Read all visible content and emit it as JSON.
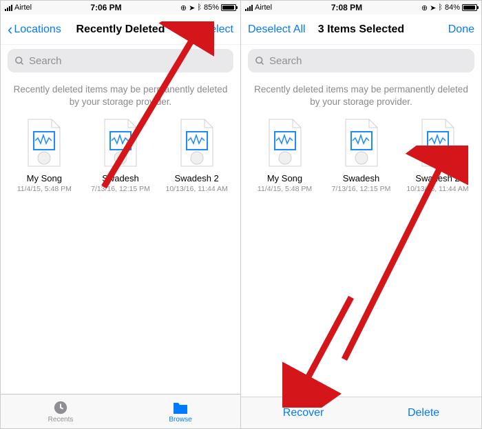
{
  "left": {
    "status": {
      "carrier": "Airtel",
      "time": "7:06 PM",
      "battery_pct": "85%",
      "battery_fill_pct": 85
    },
    "nav": {
      "back_label": "Locations",
      "title": "Recently Deleted",
      "action_label": "Select"
    },
    "search": {
      "placeholder": "Search"
    },
    "info_text": "Recently deleted items may be permanently deleted by your storage provider.",
    "files": [
      {
        "name": "My Song",
        "date": "11/4/15, 5:48 PM"
      },
      {
        "name": "Swadesh",
        "date": "7/13/16, 12:15 PM"
      },
      {
        "name": "Swadesh 2",
        "date": "10/13/16, 11:44 AM"
      }
    ],
    "tabs": {
      "recents": "Recents",
      "browse": "Browse"
    }
  },
  "right": {
    "status": {
      "carrier": "Airtel",
      "time": "7:08 PM",
      "battery_pct": "84%",
      "battery_fill_pct": 84
    },
    "nav": {
      "back_label": "Deselect All",
      "title": "3 Items Selected",
      "action_label": "Done"
    },
    "search": {
      "placeholder": "Search"
    },
    "info_text": "Recently deleted items may be permanently deleted by your storage provider.",
    "files": [
      {
        "name": "My Song",
        "date": "11/4/15, 5:48 PM"
      },
      {
        "name": "Swadesh",
        "date": "7/13/16, 12:15 PM"
      },
      {
        "name": "Swadesh 2",
        "date": "10/13/16, 11:44 AM",
        "selected": true
      }
    ],
    "actions": {
      "recover": "Recover",
      "delete": "Delete"
    }
  }
}
